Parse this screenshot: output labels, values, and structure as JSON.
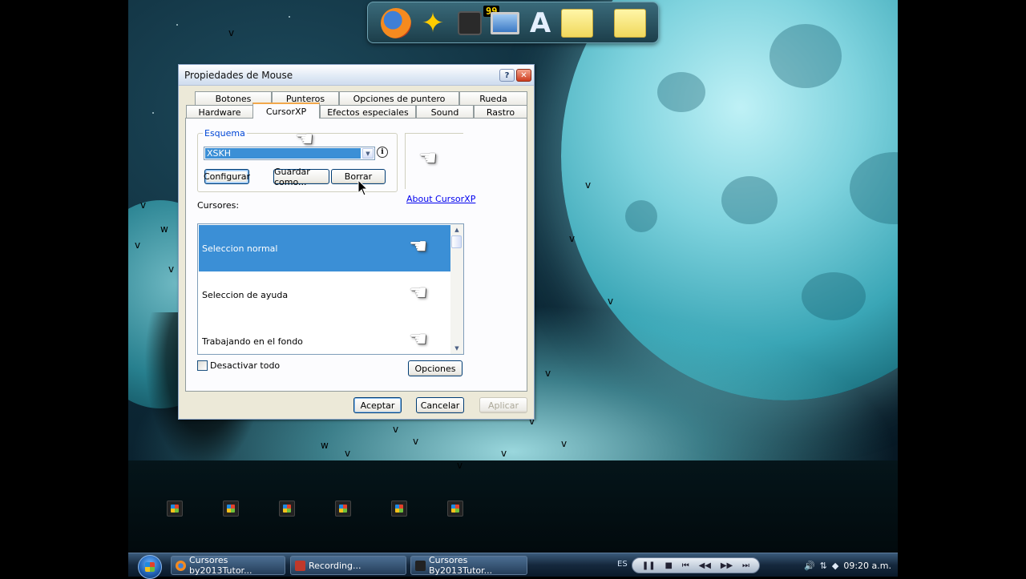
{
  "window": {
    "title": "Propiedades de Mouse",
    "help_btn": "?",
    "close_btn": "✕",
    "tabs_row1": [
      "Botones",
      "Punteros",
      "Opciones de puntero",
      "Rueda"
    ],
    "tabs_row2": [
      "Hardware",
      "CursorXP",
      "Efectos especiales",
      "Sound",
      "Rastro"
    ],
    "active_tab": "CursorXP",
    "scheme_group": "Esquema",
    "scheme_value": "XSKH",
    "buttons": {
      "configure": "Configurar",
      "save_as": "Guardar como...",
      "delete": "Borrar",
      "options": "Opciones",
      "ok": "Aceptar",
      "cancel": "Cancelar",
      "apply": "Aplicar"
    },
    "about_link": "About CursorXP",
    "cursors_label": "Cursores:",
    "cursor_items": [
      "Seleccion normal",
      "Seleccion de ayuda",
      "Trabajando en el fondo"
    ],
    "disable_all": "Desactivar todo",
    "disable_all_checked": false
  },
  "dock": {
    "badge": "99",
    "icons": [
      "firefox-icon",
      "star-app-icon",
      "camcorder-icon",
      "monitor-icon",
      "app-a-icon",
      "folder-icon",
      "folder-icon"
    ]
  },
  "taskbar": {
    "tasks": [
      "Cursores by2013Tutor...",
      "Recording...",
      "Cursores By2013Tutor..."
    ],
    "lang": "ES",
    "clock": "09:20 a.m."
  }
}
